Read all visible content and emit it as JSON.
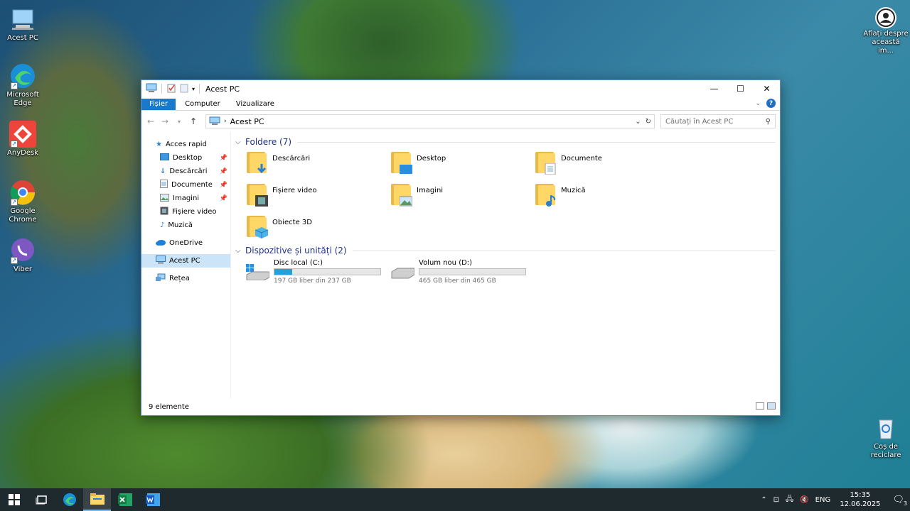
{
  "desktop": {
    "icons": [
      {
        "label": "Acest PC"
      },
      {
        "label": "Microsoft Edge"
      },
      {
        "label": "AnyDesk"
      },
      {
        "label": "Google Chrome"
      },
      {
        "label": "Viber"
      },
      {
        "label": "Aflați despre această im..."
      },
      {
        "label": "Coș de reciclare"
      }
    ]
  },
  "window": {
    "title": "Acest PC",
    "ribbon_tabs": [
      "Fișier",
      "Computer",
      "Vizualizare"
    ],
    "address": "Acest PC",
    "search_placeholder": "Căutați în Acest PC",
    "nav": {
      "quick_access": "Acces rapid",
      "quick_items": [
        "Desktop",
        "Descărcări",
        "Documente",
        "Imagini",
        "Fișiere video",
        "Muzică"
      ],
      "onedrive": "OneDrive",
      "this_pc": "Acest PC",
      "network": "Rețea"
    },
    "folders_header": "Foldere (7)",
    "folders": [
      "Descărcări",
      "Desktop",
      "Documente",
      "Fișiere video",
      "Imagini",
      "Muzică",
      "Obiecte 3D"
    ],
    "devices_header": "Dispozitive și unități (2)",
    "drives": [
      {
        "name": "Disc local (C:)",
        "free": "197 GB liber din 237 GB",
        "used_fraction": 0.17
      },
      {
        "name": "Volum nou (D:)",
        "free": "465 GB liber din 465 GB",
        "used_fraction": 0.0
      }
    ],
    "status": "9 elemente"
  },
  "taskbar": {
    "lang": "ENG",
    "time": "15:35",
    "date": "12.06.2025",
    "notif_count": "3"
  },
  "colors": {
    "accent": "#1979ca",
    "drive_fill": "#26a0da",
    "folder": "#ffd766"
  }
}
